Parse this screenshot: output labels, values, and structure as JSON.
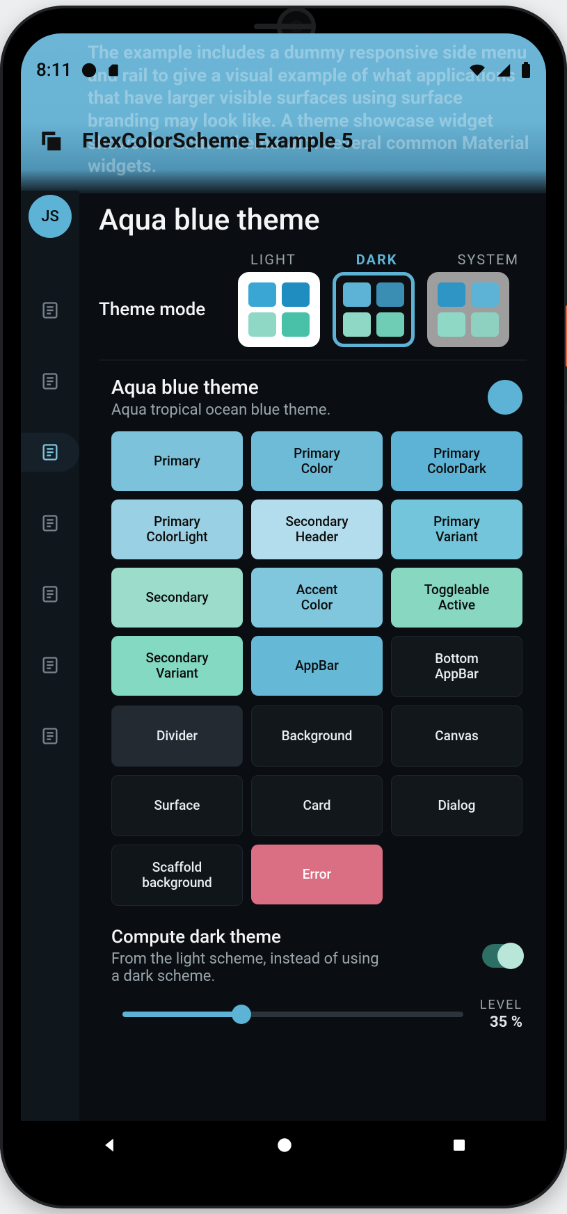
{
  "status": {
    "time": "8:11"
  },
  "bg_blurb": "The example includes a dummy responsive side menu and rail to give a visual example of what applications that have larger visible surfaces using surface branding may look like. A theme showcase widget shows the active theme with several common Material widgets.",
  "appbar": {
    "title": "FlexColorScheme Example 5"
  },
  "rail": {
    "avatar": "JS",
    "selected_index": 2,
    "items": 7
  },
  "page_title": "Aqua blue theme",
  "mode": {
    "label": "Theme mode",
    "options": [
      "LIGHT",
      "DARK",
      "SYSTEM"
    ],
    "selected": "DARK",
    "swatches": {
      "light": [
        "#3aa6d3",
        "#1f8dc0",
        "#8fd8c6",
        "#49c0a8"
      ],
      "dark": [
        "#5db3d5",
        "#3a8eb4",
        "#8fd8c6",
        "#6fcdb6"
      ],
      "system": [
        "#2e95c5",
        "#5db3d5",
        "#8fd8c6",
        "#8ed1c0"
      ]
    }
  },
  "scheme": {
    "name": "Aqua blue theme",
    "desc": "Aqua tropical ocean blue theme.",
    "seed_color": "#5db3d5"
  },
  "colors": [
    {
      "label": "Primary",
      "bg": "#7cc2db",
      "fg": "#0b0b0b"
    },
    {
      "label": "Primary\nColor",
      "bg": "#6ebbd8",
      "fg": "#0b0b0b"
    },
    {
      "label": "Primary\nColorDark",
      "bg": "#5db3d5",
      "fg": "#0b0b0b"
    },
    {
      "label": "Primary\nColorLight",
      "bg": "#9ad0e3",
      "fg": "#0b0b0b"
    },
    {
      "label": "Secondary\nHeader",
      "bg": "#b3dded",
      "fg": "#0b0b0b"
    },
    {
      "label": "Primary\nVariant",
      "bg": "#72c5db",
      "fg": "#0b0b0b"
    },
    {
      "label": "Secondary",
      "bg": "#9cdccb",
      "fg": "#0b0b0b"
    },
    {
      "label": "Accent\nColor",
      "bg": "#80c7dd",
      "fg": "#0b0b0b"
    },
    {
      "label": "Toggleable\nActive",
      "bg": "#87d7c1",
      "fg": "#0b0b0b"
    },
    {
      "label": "Secondary\nVariant",
      "bg": "#83d9c2",
      "fg": "#0b0b0b"
    },
    {
      "label": "AppBar",
      "bg": "#66b9d6",
      "fg": "#0b0b0b"
    },
    {
      "label": "Bottom\nAppBar",
      "bg": "#12171c",
      "fg": "#e9eef2",
      "dark": true
    },
    {
      "label": "Divider",
      "bg": "#232a31",
      "fg": "#e9eef2",
      "dark": true
    },
    {
      "label": "Background",
      "bg": "#12171c",
      "fg": "#e9eef2",
      "dark": true
    },
    {
      "label": "Canvas",
      "bg": "#12171c",
      "fg": "#e9eef2",
      "dark": true
    },
    {
      "label": "Surface",
      "bg": "#12171c",
      "fg": "#e9eef2",
      "dark": true
    },
    {
      "label": "Card",
      "bg": "#12171c",
      "fg": "#e9eef2",
      "dark": true
    },
    {
      "label": "Dialog",
      "bg": "#12171c",
      "fg": "#e9eef2",
      "dark": true
    },
    {
      "label": "Scaffold\nbackground",
      "bg": "#10151a",
      "fg": "#e9eef2",
      "dark": true
    },
    {
      "label": "Error",
      "bg": "#da6e82",
      "fg": "#ffffff"
    }
  ],
  "compute": {
    "title": "Compute dark theme",
    "subtitle": "From the light scheme, instead of using a dark scheme.",
    "enabled": true
  },
  "level": {
    "caption": "LEVEL",
    "value": "35 %",
    "percent": 35
  }
}
